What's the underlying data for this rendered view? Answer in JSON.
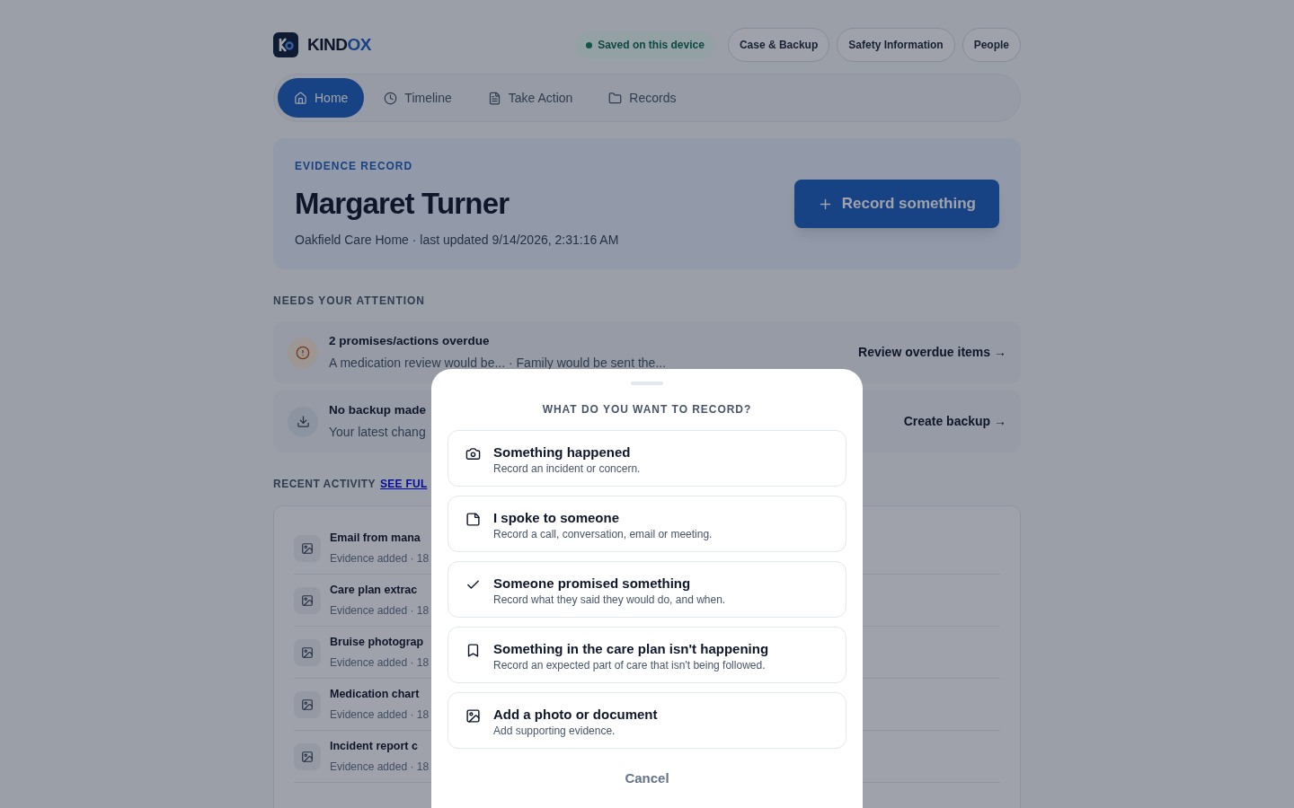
{
  "header": {
    "brand": [
      "KIND",
      "OX"
    ],
    "status": "Saved on this device",
    "links": [
      "Case & Backup",
      "Safety Information",
      "People"
    ]
  },
  "tabs": [
    {
      "label": "Home",
      "selected": true
    },
    {
      "label": "Timeline",
      "selected": false
    },
    {
      "label": "Take Action",
      "selected": false
    },
    {
      "label": "Records",
      "selected": false
    }
  ],
  "hero": {
    "eyebrow": "EVIDENCE RECORD",
    "name": "Margaret Turner",
    "subtitle": "Oakfield Care Home · last updated 9/14/2026, 2:31:16 AM",
    "action": "Record something"
  },
  "attention": {
    "heading": "NEEDS YOUR ATTENTION",
    "items": [
      {
        "kind": "warning",
        "title": "2 promises/actions overdue",
        "detail": "A medication review would be... · Family would be sent the...",
        "action": "Review overdue items →"
      },
      {
        "kind": "backup",
        "title": "No backup made",
        "detail": "Your latest chang",
        "action": "Create backup →"
      }
    ]
  },
  "recent": {
    "heading": "RECENT ACTIVITY",
    "link": "SEE FUL",
    "rows": [
      {
        "title": "Email from mana",
        "meta": "Evidence added · 18"
      },
      {
        "title": "Care plan extrac",
        "meta": "Evidence added · 18"
      },
      {
        "title": "Bruise photograp",
        "meta": "Evidence added · 18"
      },
      {
        "title": "Medication chart",
        "meta": "Evidence added · 18"
      },
      {
        "title": "Incident report c",
        "meta": "Evidence added · 18"
      }
    ]
  },
  "modal": {
    "heading": "WHAT DO YOU WANT TO RECORD?",
    "options": [
      {
        "title": "Something happened",
        "description": "Record an incident or concern."
      },
      {
        "title": "I spoke to someone",
        "description": "Record a call, conversation, email or meeting."
      },
      {
        "title": "Someone promised something",
        "description": "Record what they said they would do, and when."
      },
      {
        "title": "Something in the care plan isn't happening",
        "description": "Record an expected part of care that isn't being followed."
      },
      {
        "title": "Add a photo or document",
        "description": "Add supporting evidence."
      }
    ],
    "cancel": "Cancel"
  }
}
